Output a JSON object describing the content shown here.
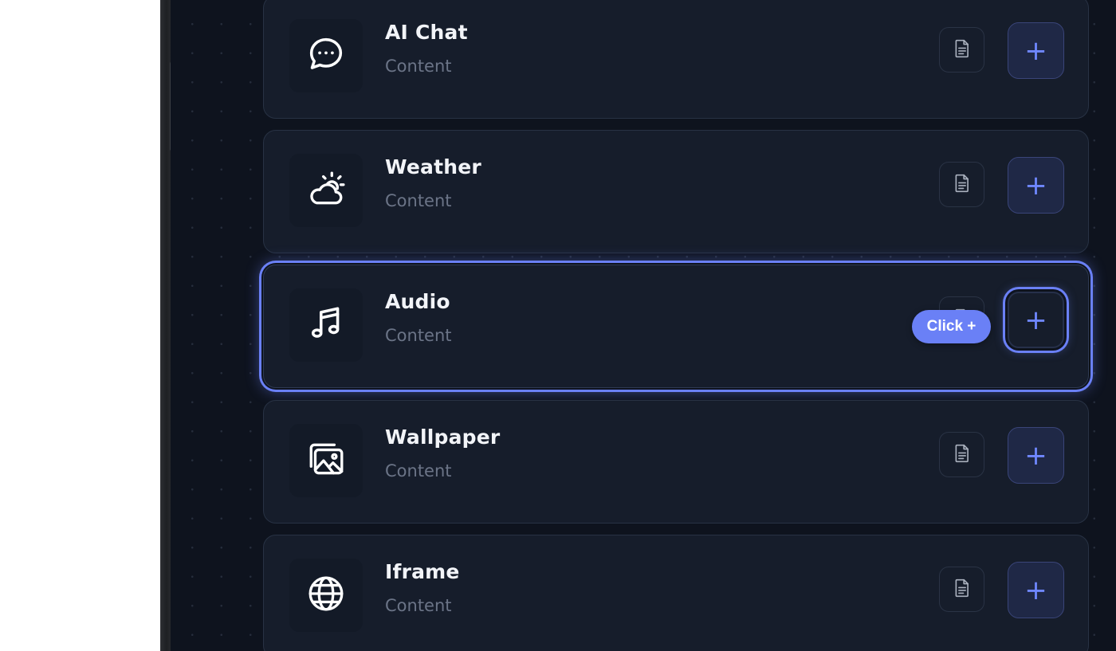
{
  "accent_color": "#6a80f6",
  "cards": [
    {
      "title": "AI Chat",
      "subtitle": "Content",
      "icon": "chat-bubble-icon"
    },
    {
      "title": "Weather",
      "subtitle": "Content",
      "icon": "weather-cloud-sun-icon"
    },
    {
      "title": "Audio",
      "subtitle": "Content",
      "icon": "music-note-icon",
      "selected": true
    },
    {
      "title": "Wallpaper",
      "subtitle": "Content",
      "icon": "image-gallery-icon"
    },
    {
      "title": "Iframe",
      "subtitle": "Content",
      "icon": "globe-icon"
    }
  ],
  "buttons": {
    "doc_icon": "document-icon",
    "add_label": "+"
  },
  "tooltip": {
    "label": "Click +"
  }
}
